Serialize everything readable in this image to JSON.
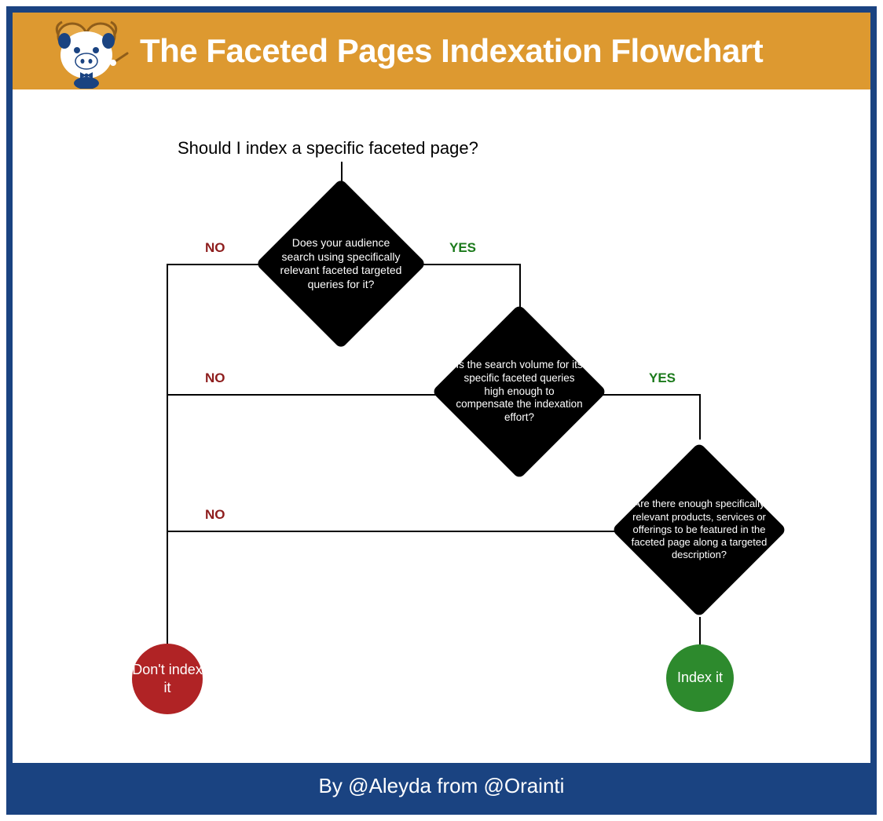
{
  "header": {
    "title": "The Faceted Pages Indexation Flowchart"
  },
  "flowchart": {
    "start_question": "Should I index a specific faceted page?",
    "decisions": [
      "Does your audience search using specifically relevant faceted targeted queries for it?",
      "Is the search volume for its specific faceted queries high enough to compensate the indexation effort?",
      "Are there enough specifically relevant products, services or offerings to be featured in the faceted page along a targeted description?"
    ],
    "labels": {
      "yes": "YES",
      "no": "NO"
    },
    "terminals": {
      "no_result": "Don't index it",
      "yes_result": "Index it"
    }
  },
  "footer": {
    "text": "By @Aleyda from @Orainti"
  },
  "colors": {
    "frame_blue": "#1a4381",
    "header_orange": "#dd9930",
    "no_red": "#8e1d1d",
    "yes_green": "#1b7a1b",
    "circle_red": "#b02325",
    "circle_green": "#2d8a2d"
  }
}
